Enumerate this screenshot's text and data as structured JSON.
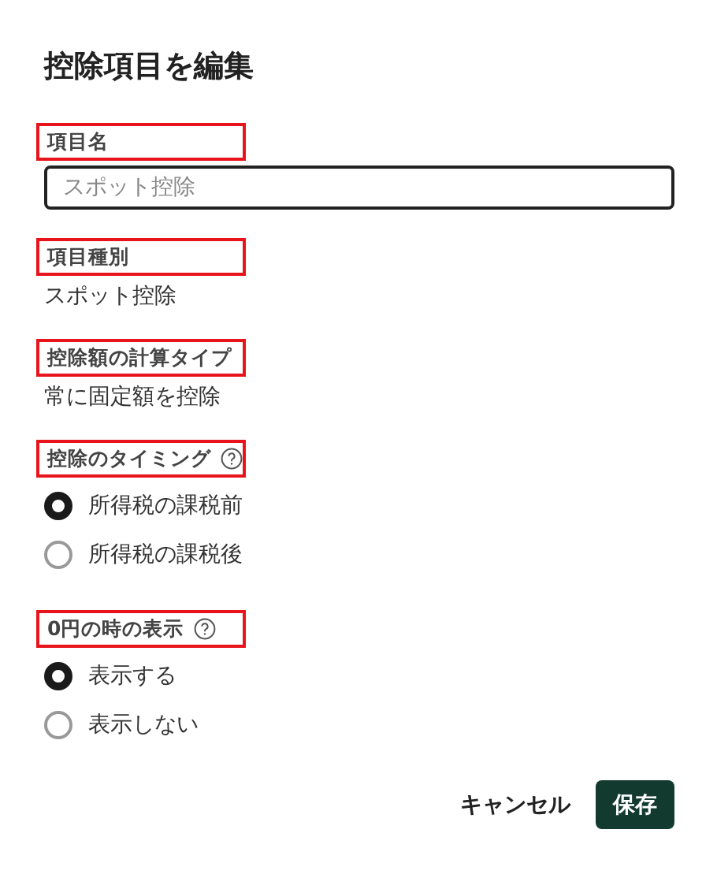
{
  "dialog": {
    "title": "控除項目を編集"
  },
  "fields": [
    {
      "kind": "input",
      "label": "項目名",
      "highlighted": true,
      "help": false,
      "placeholder": "スポット控除"
    },
    {
      "kind": "text",
      "label": "項目種別",
      "highlighted": true,
      "help": false,
      "value": "スポット控除"
    },
    {
      "kind": "text",
      "label": "控除額の計算タイプ",
      "highlighted": true,
      "help": false,
      "value": "常に固定額を控除"
    },
    {
      "kind": "radio",
      "label": "控除のタイミング",
      "highlighted": true,
      "help": true,
      "options": [
        {
          "label": "所得税の課税前",
          "selected": true
        },
        {
          "label": "所得税の課税後",
          "selected": false
        }
      ]
    },
    {
      "kind": "radio",
      "label": "0円の時の表示",
      "highlighted": true,
      "help": true,
      "options": [
        {
          "label": "表示する",
          "selected": true
        },
        {
          "label": "表示しない",
          "selected": false
        }
      ]
    }
  ],
  "buttons": {
    "cancel": "キャンセル",
    "save": "保存"
  }
}
